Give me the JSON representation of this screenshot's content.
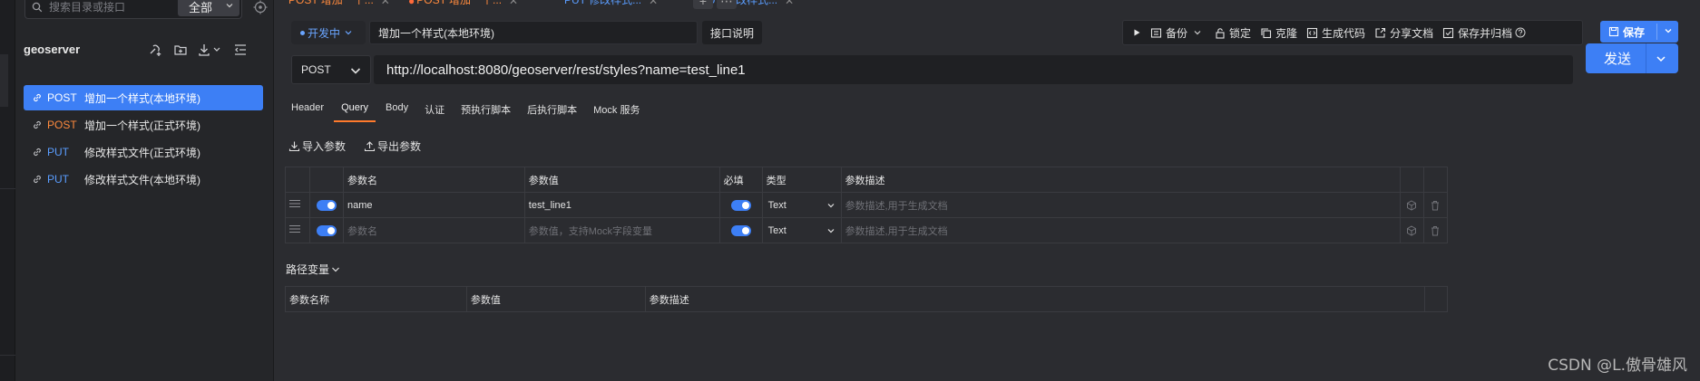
{
  "sidebar": {
    "search": {
      "placeholder": "搜索目录或接口",
      "scope": "全部"
    },
    "project": "geoserver",
    "items": [
      {
        "method": "POST",
        "name": "增加一个样式(本地环境)",
        "active": true
      },
      {
        "method": "POST",
        "name": "增加一个样式(正式环境)",
        "active": false
      },
      {
        "method": "PUT",
        "name": "修改样式文件(正式环境)",
        "active": false
      },
      {
        "method": "PUT",
        "name": "修改样式文件(本地环境)",
        "active": false
      }
    ]
  },
  "tabs": [
    {
      "method": "POST",
      "label": "POST 增加一个..."
    },
    {
      "method": "POST",
      "label": "POST 增加一个..."
    },
    {
      "method": "PUT",
      "label": "PUT 修改样式..."
    },
    {
      "method": "PUT",
      "label": "PUT 修改样式..."
    }
  ],
  "toolbar": {
    "env": "开发中",
    "api_name": "增加一个样式(本地环境)",
    "doc_button": "接口说明",
    "actions": {
      "backup": "备份",
      "lock": "锁定",
      "clone": "克隆",
      "gen_code": "生成代码",
      "share": "分享文档",
      "save_archive": "保存并归档"
    },
    "save": "保存"
  },
  "request": {
    "method": "POST",
    "url": "http://localhost:8080/geoserver/rest/styles?name=test_line1",
    "send": "发送",
    "tabs": [
      "Header",
      "Query",
      "Body",
      "认证",
      "预执行脚本",
      "后执行脚本",
      "Mock 服务"
    ],
    "active_tab": "Query",
    "import": "导入参数",
    "export": "导出参数"
  },
  "query": {
    "headers": {
      "name": "参数名",
      "value": "参数值",
      "required": "必填",
      "type": "类型",
      "desc": "参数描述"
    },
    "rows": [
      {
        "name": "name",
        "value": "test_line1",
        "type": "Text",
        "desc_placeholder": "参数描述,用于生成文档"
      },
      {
        "name_placeholder": "参数名",
        "value_placeholder": "参数值，支持Mock字段变量",
        "type": "Text",
        "desc_placeholder": "参数描述,用于生成文档"
      }
    ]
  },
  "path_vars": {
    "title": "路径变量",
    "headers": {
      "name": "参数名称",
      "value": "参数值",
      "desc": "参数描述"
    }
  },
  "watermark": "CSDN @L.傲骨雄风",
  "colors": {
    "accent": "#3d7ff5",
    "post": "#ff8a3d",
    "put": "#5a9dff",
    "active_tab": "#ff7a2c"
  }
}
